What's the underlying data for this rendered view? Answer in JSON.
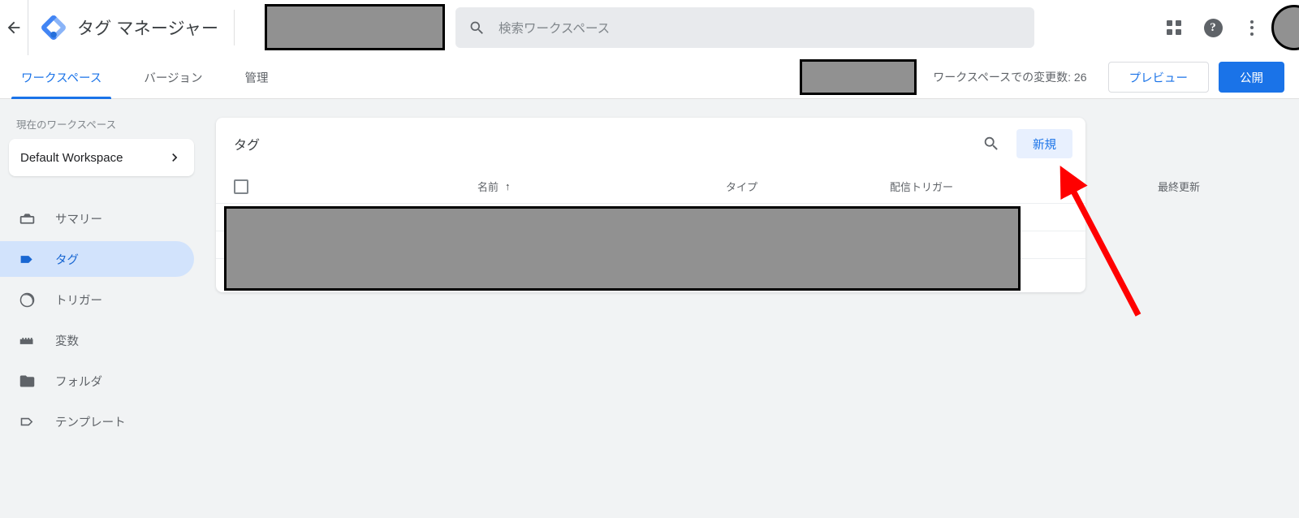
{
  "header": {
    "back_icon": "arrow-left-icon",
    "logo": "tag-manager-logo",
    "title": "タグ マネージャー",
    "search": {
      "icon": "search-icon",
      "placeholder": "検索ワークスペース",
      "value": ""
    },
    "apps_icon": "apps-grid-icon",
    "help_icon": "help-icon",
    "help_glyph": "?",
    "more_icon": "more-vert-icon",
    "avatar": "account-avatar"
  },
  "tabbar": {
    "tabs": [
      {
        "label": "ワークスペース",
        "active": true
      },
      {
        "label": "バージョン",
        "active": false
      },
      {
        "label": "管理",
        "active": false
      }
    ],
    "changes_text": "ワークスペースでの変更数: 26",
    "preview_label": "プレビュー",
    "publish_label": "公開"
  },
  "sidebar": {
    "workspace_label": "現在のワークスペース",
    "workspace_name": "Default Workspace",
    "workspace_chevron": "chevron-right-icon",
    "items": [
      {
        "label": "サマリー",
        "icon": "summary-icon",
        "active": false
      },
      {
        "label": "タグ",
        "icon": "tag-icon",
        "active": true
      },
      {
        "label": "トリガー",
        "icon": "trigger-icon",
        "active": false
      },
      {
        "label": "変数",
        "icon": "variable-icon",
        "active": false
      },
      {
        "label": "フォルダ",
        "icon": "folder-icon",
        "active": false
      },
      {
        "label": "テンプレート",
        "icon": "template-icon",
        "active": false
      }
    ]
  },
  "main": {
    "card_title": "タグ",
    "search_icon": "search-icon",
    "new_button_label": "新規",
    "columns": {
      "name": "名前",
      "sort_arrow": "↑",
      "type": "タイプ",
      "trigger": "配信トリガー",
      "updated": "最終更新"
    },
    "select_all_checkbox": "unchecked"
  },
  "annotation": {
    "arrow_color": "#ff0000",
    "arrow_target": "新規"
  },
  "colors": {
    "accent_blue": "#1a73e8",
    "active_nav_bg": "#d2e3fc",
    "active_nav_fg": "#1967d2",
    "new_btn_bg": "#e8f0fe",
    "page_bg": "#f1f3f4",
    "redaction": "#919191"
  }
}
